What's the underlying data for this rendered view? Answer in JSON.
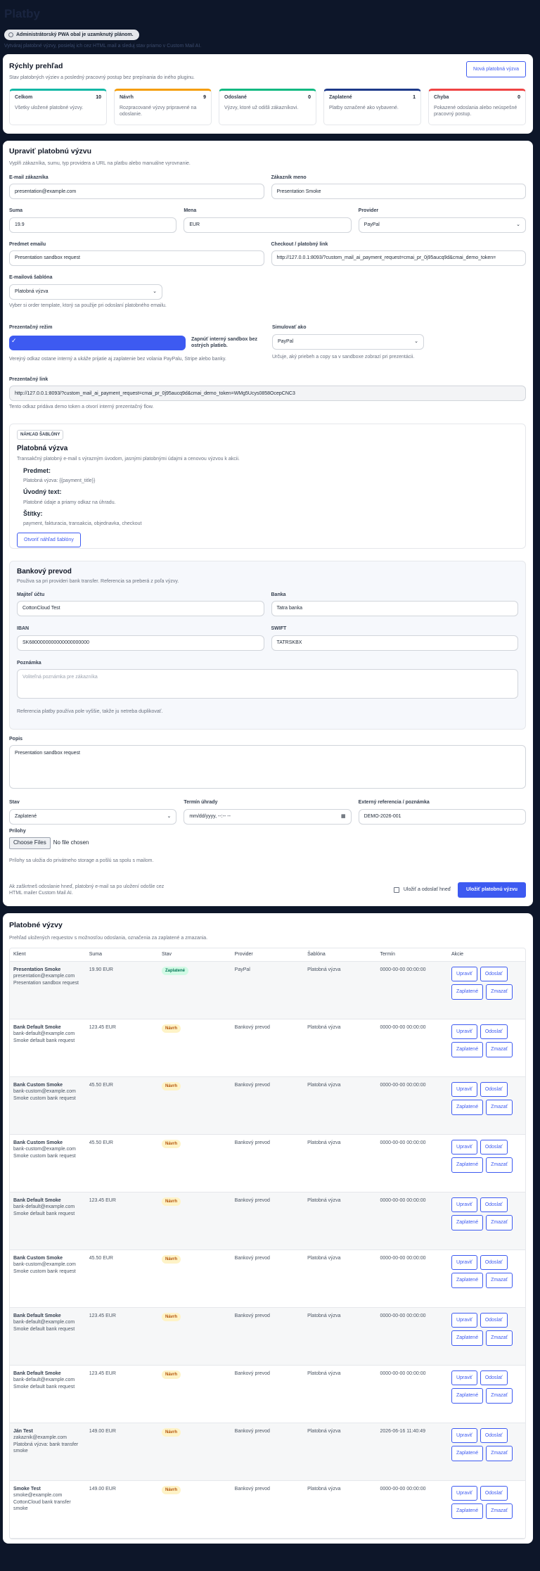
{
  "header": {
    "title": "Platby",
    "pwa_badge": "Administrátorský PWA obal je uzamknutý plánom.",
    "subtitle": "Vytváraj platobné výzvy, posielaj ich cez HTML mail a sleduj stav priamo v Custom Mail AI."
  },
  "overview": {
    "title": "Rýchly prehľad",
    "desc": "Stav platobných výziev a posledný pracovný postup bez prepínania do iného pluginu.",
    "new_button": "Nová platobná výzva",
    "stats": [
      {
        "label": "Celkom",
        "count": "10",
        "desc": "Všetky uložené platobné výzvy.",
        "color": "#14b8a6"
      },
      {
        "label": "Návrh",
        "count": "9",
        "desc": "Rozpracované výzvy pripravené na odoslanie.",
        "color": "#f59e0b"
      },
      {
        "label": "Odoslané",
        "count": "0",
        "desc": "Výzvy, ktoré už odišli zákazníkovi.",
        "color": "#10b981"
      },
      {
        "label": "Zaplatené",
        "count": "1",
        "desc": "Platby označené ako vybavené.",
        "color": "#1e3a8a"
      },
      {
        "label": "Chyba",
        "count": "0",
        "desc": "Pokazené odoslania alebo neúspešné pracovný postup.",
        "color": "#ef4444"
      }
    ]
  },
  "edit": {
    "title": "Upraviť platobnú výzvu",
    "desc": "Vyplň zákazníka, sumu, typ providera a URL na platbu alebo manuálne vyrovnanie.",
    "email_label": "E-mail zákazníka",
    "email": "presentation@example.com",
    "name_label": "Zákazník meno",
    "name": "Presentation Smoke",
    "amount_label": "Suma",
    "amount": "19.9",
    "currency_label": "Mena",
    "currency": "EUR",
    "provider_label": "Provider",
    "provider": "PayPal",
    "subject_label": "Predmet emailu",
    "subject": "Presentation sandbox request",
    "checkout_label": "Checkout / platobný link",
    "checkout": "http://127.0.0.1:8093/?custom_mail_ai_payment_request=cmai_pr_0j95aucq9d&cmai_demo_token=",
    "template_label": "E-mailová šablóna",
    "template": "Platobná výzva",
    "template_hint": "Vyber si order template, ktorý sa použije pri odoslaní platobného emailu.",
    "presentation_label": "Prezentačný režim",
    "presentation_toggle": "Zapnúť interný sandbox bez ostrých platieb.",
    "presentation_hint": "Verejný odkaz ostane interný a ukáže prijatie aj zaplatenie bez volania PayPalu, Stripe alebo banky.",
    "simulate_label": "Simulovať ako",
    "simulate": "PayPal",
    "simulate_hint": "Určuje, aký priebeh a copy sa v sandboxe zobrazí pri prezentácii.",
    "plink_label": "Prezentačný link",
    "plink": "http://127.0.0.1:8093/?custom_mail_ai_payment_request=cmai_pr_0j95aucq9d&cmai_demo_token=WMg5Ucys0858OcepCNC3",
    "plink_hint": "Tento odkaz pridáva demo token a otvorí interný prezentačný flow.",
    "preview": {
      "tag": "NÁHĽAD ŠABLÓNY",
      "title": "Platobná výzva",
      "desc": "Transakčný platobný e-mail s výrazným úvodom, jasnými platobnými údajmi a cenovou výzvou k akcii.",
      "subject_h": "Predmet:",
      "subject_v": "Platobná výzva: {{payment_title}}",
      "intro_h": "Úvodný text:",
      "intro_v": "Platobné údaje a priamy odkaz na úhradu.",
      "tags_h": "Štítky:",
      "tags_v": "payment, fakturacia, transakcia, objednavka, checkout",
      "open_button": "Otvoriť náhľad šablóny"
    },
    "bank": {
      "title": "Bankový prevod",
      "desc": "Použiva sa pri provideri bank transfer. Referencia sa preberá z poľa výzvy.",
      "owner_label": "Majiteľ účtu",
      "owner": "CottonCloud Test",
      "bank_label": "Banka",
      "bank": "Tatra banka",
      "iban_label": "IBAN",
      "iban": "SK6800000000000000000000",
      "swift_label": "SWIFT",
      "swift": "TATRSKBX",
      "note_label": "Poznámka",
      "note_placeholder": "Voliteľná poznámka pre zákazníka",
      "hint": "Referencia platby používa pole vyššie, takže ju netreba duplikovať."
    },
    "desc_label": "Popis",
    "description": "Presentation sandbox request",
    "status_label": "Stav",
    "status": "Zaplatené",
    "due_label": "Termín úhrady",
    "due": "mm/dd/yyyy, --:-- --",
    "ref_label": "Externý referencia / poznámka",
    "ref": "DEMO-2026-001",
    "attach_label": "Prílohy",
    "choose": "Choose Files",
    "nofile": "No file chosen",
    "attach_hint": "Prílohy sa uložia do privátneho storage a pošlú sa spolu s mailom.",
    "footer_hint": "Ak zaškrtneš odoslanie hneď, platobný e-mail sa po uložení odošle cez HTML mailer Custom Mail AI.",
    "send_now": "Uložiť a odoslať hneď",
    "save_button": "Uložiť platobnú výzvu"
  },
  "list": {
    "title": "Platobné výzvy",
    "desc": "Prehľad uložených requestov s možnosťou odoslania, označenia za zaplatené a zmazania.",
    "columns": [
      "Klient",
      "Suma",
      "Stav",
      "Provider",
      "Šablóna",
      "Termín",
      "Akcie"
    ],
    "actions": {
      "edit": "Upraviť",
      "send": "Odoslať",
      "paid": "Zaplatené",
      "delete": "Zmazať"
    },
    "rows": [
      {
        "name": "Presentation Smoke",
        "email": "presentation@example.com",
        "note": "Presentation sandbox request",
        "amount": "19.90 EUR",
        "status": "Zaplatené",
        "paid": true,
        "provider": "PayPal",
        "template": "Platobná výzva",
        "term": "0000-00-00 00:00:00"
      },
      {
        "name": "Bank Default Smoke",
        "email": "bank-default@example.com",
        "note": "Smoke default bank request",
        "amount": "123.45 EUR",
        "status": "Návrh",
        "paid": false,
        "provider": "Bankový prevod",
        "template": "Platobná výzva",
        "term": "0000-00-00 00:00:00"
      },
      {
        "name": "Bank Custom Smoke",
        "email": "bank-custom@example.com",
        "note": "Smoke custom bank request",
        "amount": "45.50 EUR",
        "status": "Návrh",
        "paid": false,
        "provider": "Bankový prevod",
        "template": "Platobná výzva",
        "term": "0000-00-00 00:00:00"
      },
      {
        "name": "Bank Custom Smoke",
        "email": "bank-custom@example.com",
        "note": "Smoke custom bank request",
        "amount": "45.50 EUR",
        "status": "Návrh",
        "paid": false,
        "provider": "Bankový prevod",
        "template": "Platobná výzva",
        "term": "0000-00-00 00:00:00"
      },
      {
        "name": "Bank Default Smoke",
        "email": "bank-default@example.com",
        "note": "Smoke default bank request",
        "amount": "123.45 EUR",
        "status": "Návrh",
        "paid": false,
        "provider": "Bankový prevod",
        "template": "Platobná výzva",
        "term": "0000-00-00 00:00:00"
      },
      {
        "name": "Bank Custom Smoke",
        "email": "bank-custom@example.com",
        "note": "Smoke custom bank request",
        "amount": "45.50 EUR",
        "status": "Návrh",
        "paid": false,
        "provider": "Bankový prevod",
        "template": "Platobná výzva",
        "term": "0000-00-00 00:00:00"
      },
      {
        "name": "Bank Default Smoke",
        "email": "bank-default@example.com",
        "note": "Smoke default bank request",
        "amount": "123.45 EUR",
        "status": "Návrh",
        "paid": false,
        "provider": "Bankový prevod",
        "template": "Platobná výzva",
        "term": "0000-00-00 00:00:00"
      },
      {
        "name": "Bank Default Smoke",
        "email": "bank-default@example.com",
        "note": "Smoke default bank request",
        "amount": "123.45 EUR",
        "status": "Návrh",
        "paid": false,
        "provider": "Bankový prevod",
        "template": "Platobná výzva",
        "term": "0000-00-00 00:00:00"
      },
      {
        "name": "Ján Test",
        "email": "zakaznik@example.com",
        "note": "Platobná výzva: bank transfer smoke",
        "amount": "149.00 EUR",
        "status": "Návrh",
        "paid": false,
        "provider": "Bankový prevod",
        "template": "Platobná výzva",
        "term": "2026-06-16 11:40:49"
      },
      {
        "name": "Smoke Test",
        "email": "smoke@example.com",
        "note": "CottonCloud bank transfer smoke",
        "amount": "149.00 EUR",
        "status": "Návrh",
        "paid": false,
        "provider": "Bankový prevod",
        "template": "Platobná výzva",
        "term": "0000-00-00 00:00:00"
      }
    ]
  }
}
